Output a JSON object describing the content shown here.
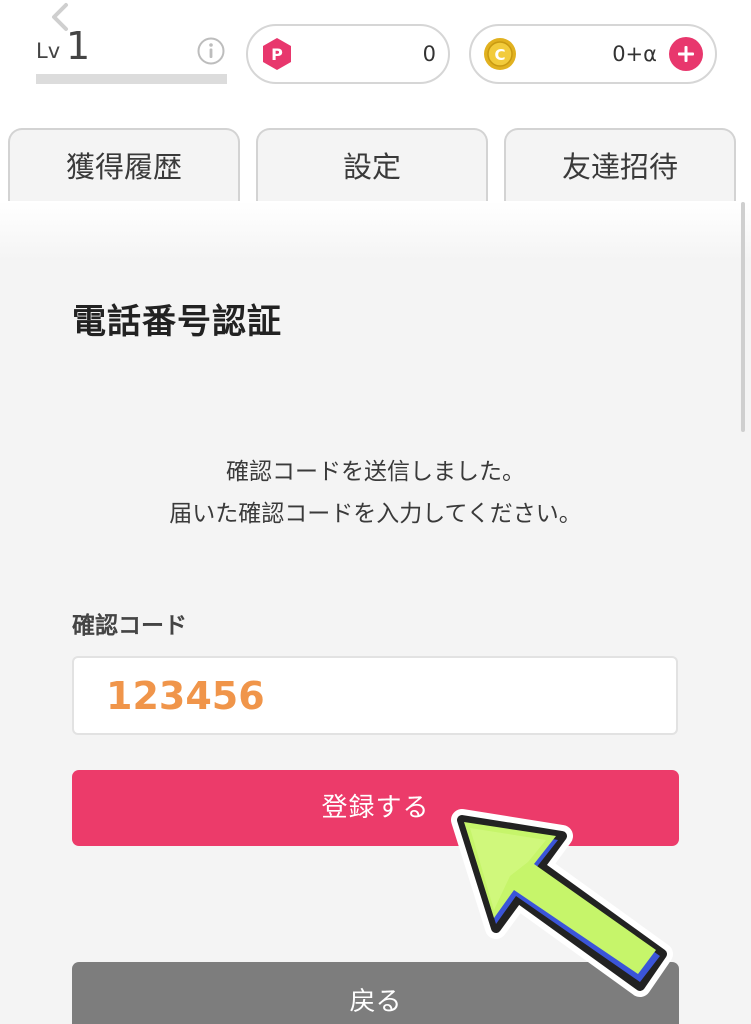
{
  "header": {
    "level_prefix": "Lv",
    "level_value": "1",
    "points_badge_letter": "P",
    "points_value": "0",
    "coins_badge_letter": "C",
    "coins_value": "0+α"
  },
  "tabs": [
    {
      "label": "獲得履歴",
      "active": false
    },
    {
      "label": "設定",
      "active": true
    },
    {
      "label": "友達招待",
      "active": false
    }
  ],
  "main": {
    "title": "電話番号認証",
    "message_line1": "確認コードを送信しました。",
    "message_line2": "届いた確認コードを入力してください。",
    "code_label": "確認コード",
    "code_value": "123456",
    "register_label": "登録する",
    "back_label": "戻る"
  },
  "colors": {
    "primary_pink": "#ec3b6a",
    "gray_button": "#7d7d7d",
    "code_text_orange": "#f0954a",
    "coin_gold": "#e1b11f",
    "annotation_arrow_green": "#c6f56a",
    "annotation_arrow_shadow": "#3b55d9"
  },
  "icons": {
    "back": "chevron-left-icon",
    "info": "info-icon",
    "points": "points-badge-icon",
    "coins": "coin-icon",
    "add": "plus-icon",
    "annotation": "pointer-arrow-icon"
  }
}
